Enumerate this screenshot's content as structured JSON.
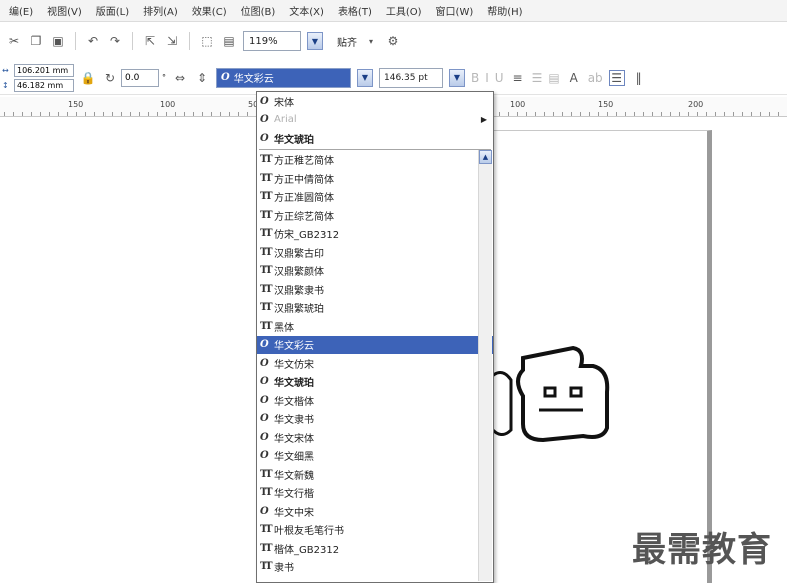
{
  "menu": [
    "编(E)",
    "视图(V)",
    "版面(L)",
    "排列(A)",
    "效果(C)",
    "位图(B)",
    "文本(X)",
    "表格(T)",
    "工具(O)",
    "窗口(W)",
    "帮助(H)"
  ],
  "toolbar": {
    "zoom": "119%",
    "align_label": "贴齐"
  },
  "properties": {
    "width": "106.201 mm",
    "height": "46.182 mm",
    "rotation": "0.0",
    "font_name": "华文彩云",
    "font_size": "146.35 pt"
  },
  "ruler": [
    "150",
    "100",
    "50",
    "100",
    "150",
    "200"
  ],
  "font_list": {
    "recent": [
      {
        "name": "宋体",
        "type": "opentype",
        "style": "normal"
      },
      {
        "name": "Arial",
        "type": "opentype",
        "style": "gray"
      },
      {
        "name": "华文琥珀",
        "type": "opentype",
        "style": "bold"
      }
    ],
    "fonts": [
      {
        "name": "方正稚艺简体",
        "type": "truetype"
      },
      {
        "name": "方正中倩简体",
        "type": "truetype"
      },
      {
        "name": "方正准圆简体",
        "type": "truetype"
      },
      {
        "name": "方正综艺简体",
        "type": "truetype"
      },
      {
        "name": "仿宋_GB2312",
        "type": "truetype"
      },
      {
        "name": "汉鼎繁古印",
        "type": "truetype"
      },
      {
        "name": "汉鼎繁颜体",
        "type": "truetype"
      },
      {
        "name": "汉鼎繁隶书",
        "type": "truetype"
      },
      {
        "name": "汉鼎繁琥珀",
        "type": "truetype"
      },
      {
        "name": "黑体",
        "type": "truetype"
      },
      {
        "name": "华文彩云",
        "type": "opentype",
        "selected": true
      },
      {
        "name": "华文仿宋",
        "type": "opentype"
      },
      {
        "name": "华文琥珀",
        "type": "opentype",
        "bold": true
      },
      {
        "name": "华文楷体",
        "type": "opentype"
      },
      {
        "name": "华文隶书",
        "type": "opentype"
      },
      {
        "name": "华文宋体",
        "type": "opentype"
      },
      {
        "name": "华文细黑",
        "type": "opentype"
      },
      {
        "name": "华文新魏",
        "type": "truetype"
      },
      {
        "name": "华文行楷",
        "type": "truetype"
      },
      {
        "name": "华文中宋",
        "type": "opentype"
      },
      {
        "name": "叶根友毛笔行书",
        "type": "truetype"
      },
      {
        "name": "楷体_GB2312",
        "type": "truetype"
      },
      {
        "name": "隶书",
        "type": "truetype"
      }
    ]
  },
  "watermark": "最需教育",
  "colors": {
    "selection": "#3d63b8"
  }
}
